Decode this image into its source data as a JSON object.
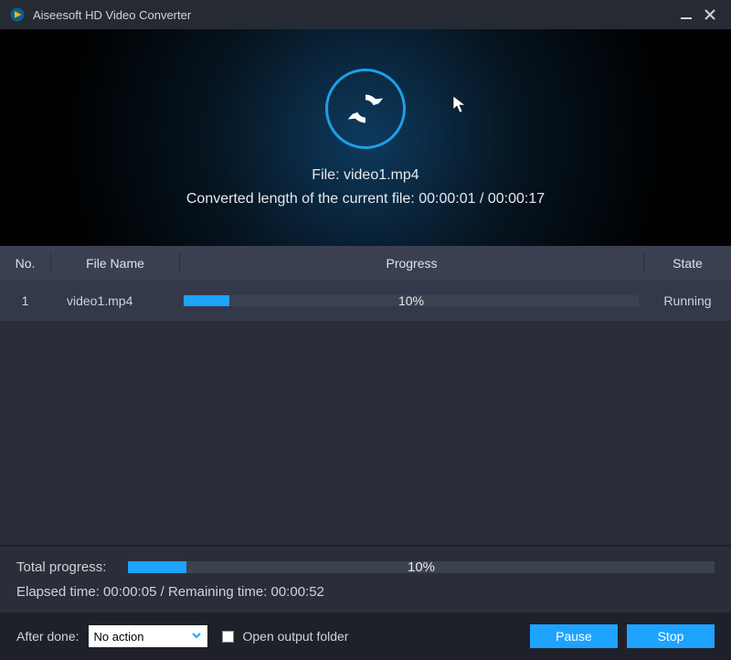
{
  "titlebar": {
    "title": "Aiseesoft HD Video Converter"
  },
  "hero": {
    "file_line_prefix": "File: ",
    "file_name": "video1.mp4",
    "converted_prefix": "Converted length of the current file: ",
    "converted_pos": "00:00:01",
    "converted_sep": " / ",
    "converted_total": "00:00:17"
  },
  "headers": {
    "no": "No.",
    "file_name": "File Name",
    "progress": "Progress",
    "state": "State"
  },
  "rows": [
    {
      "no": "1",
      "file_name": "video1.mp4",
      "percent": "10%",
      "percent_num": 10,
      "state": "Running"
    }
  ],
  "total": {
    "label": "Total progress:",
    "percent": "10%",
    "percent_num": 10,
    "elapsed_label": "Elapsed time: ",
    "elapsed": "00:00:05",
    "sep": " / ",
    "remaining_label": "Remaining time: ",
    "remaining": "00:00:52"
  },
  "footer": {
    "after_done_label": "After done:",
    "after_done_value": "No action",
    "open_output_label": "Open output folder",
    "open_output_checked": false,
    "pause_label": "Pause",
    "stop_label": "Stop"
  },
  "colors": {
    "accent": "#1ea3ff"
  }
}
